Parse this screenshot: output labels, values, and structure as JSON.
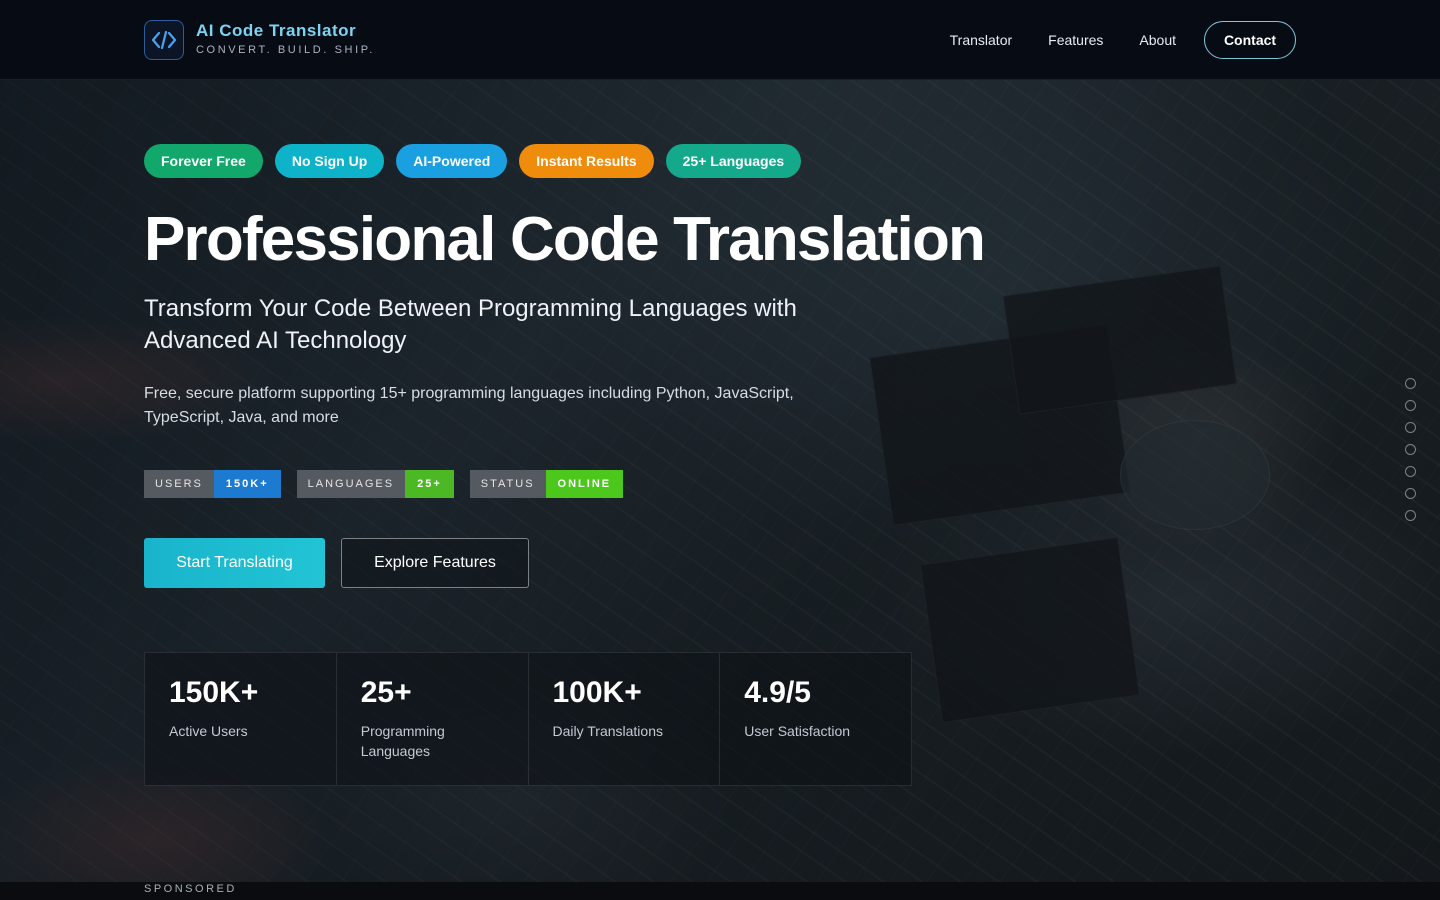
{
  "header": {
    "brand_title": "AI Code Translator",
    "brand_tagline": "CONVERT. BUILD. SHIP.",
    "logo_icon": "code-brackets-icon",
    "nav": [
      "Translator",
      "Features",
      "About"
    ],
    "contact_label": "Contact"
  },
  "hero": {
    "pills": [
      {
        "label": "Forever Free",
        "color": "#12a86b"
      },
      {
        "label": "No Sign Up",
        "color": "#0fb3c9"
      },
      {
        "label": "AI-Powered",
        "color": "#1a9fe0"
      },
      {
        "label": "Instant Results",
        "color": "#f08c0c"
      },
      {
        "label": "25+ Languages",
        "color": "#15a98c"
      }
    ],
    "title": "Professional Code Translation",
    "subtitle": "Transform Your Code Between Programming Languages with Advanced AI Technology",
    "description": "Free, secure platform supporting 15+ programming languages including Python, JavaScript, TypeScript, Java, and more",
    "badges": [
      {
        "key": "USERS",
        "value": "150K+",
        "color": "#1c7bd1"
      },
      {
        "key": "LANGUAGES",
        "value": "25+",
        "color": "#4cb824"
      },
      {
        "key": "STATUS",
        "value": "ONLINE",
        "color": "#4cc71c"
      }
    ],
    "primary_button": "Start Translating",
    "secondary_button": "Explore Features",
    "stats": [
      {
        "number": "150K+",
        "label": "Active Users"
      },
      {
        "number": "25+",
        "label": "Programming Languages"
      },
      {
        "number": "100K+",
        "label": "Daily Translations"
      },
      {
        "number": "4.9/5",
        "label": "User Satisfaction"
      }
    ]
  },
  "footer": {
    "sponsored_label": "SPONSORED"
  }
}
